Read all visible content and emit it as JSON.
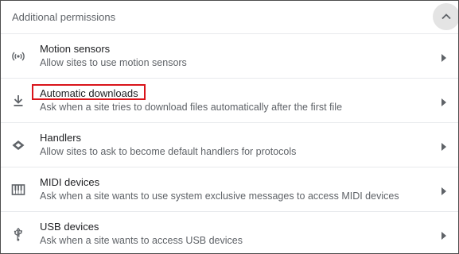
{
  "header": {
    "title": "Additional permissions",
    "collapse_icon": "chevron-up-icon"
  },
  "rows": [
    {
      "title": "Motion sensors",
      "description": "Allow sites to use motion sensors",
      "icon": "motion-sensors-icon"
    },
    {
      "title": "Automatic downloads",
      "description": "Ask when a site tries to download files automatically after the first file",
      "icon": "download-icon",
      "highlighted": true
    },
    {
      "title": "Handlers",
      "description": "Allow sites to ask to become default handlers for protocols",
      "icon": "handlers-icon"
    },
    {
      "title": "MIDI devices",
      "description": "Ask when a site wants to use system exclusive messages to access MIDI devices",
      "icon": "midi-icon"
    },
    {
      "title": "USB devices",
      "description": "Ask when a site wants to access USB devices",
      "icon": "usb-icon"
    }
  ],
  "colors": {
    "highlight_border": "#d9141a",
    "title_text": "#202124",
    "secondary_text": "#5f6368",
    "collapse_button_bg": "#e4e4e4"
  }
}
